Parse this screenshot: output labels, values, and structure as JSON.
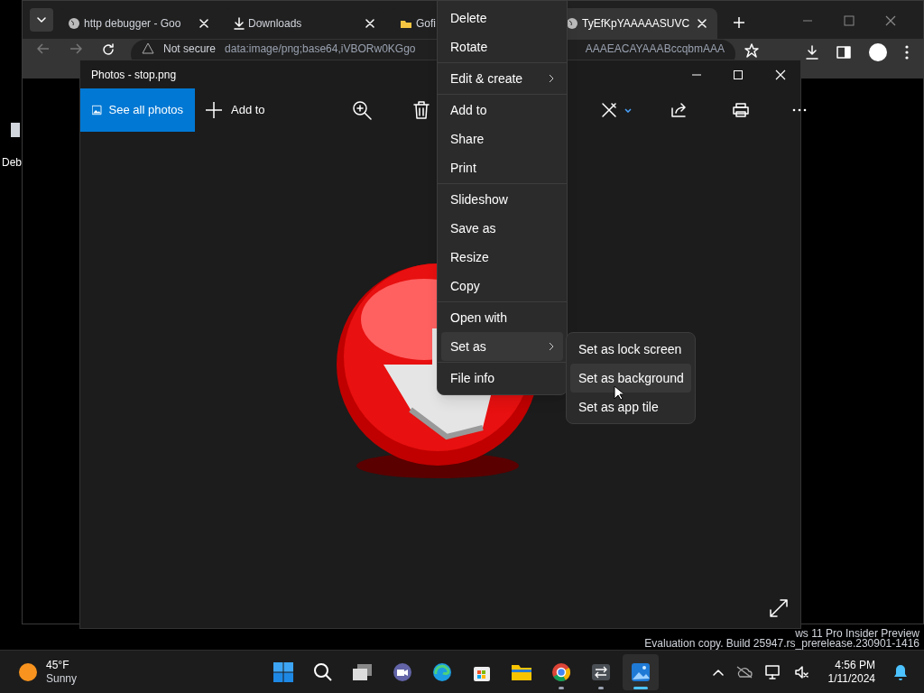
{
  "desktop": {
    "icon_label": "Deb"
  },
  "browser": {
    "tabs": [
      {
        "kind": "globe",
        "title": "http debugger - Goo",
        "selected": false
      },
      {
        "kind": "download",
        "title": "Downloads",
        "selected": false
      },
      {
        "kind": "folder",
        "title": "Gofi",
        "selected": false
      },
      {
        "kind": "globe",
        "title": "TyEfKpYAAAAASUVC",
        "selected": true
      }
    ],
    "address": {
      "security": "Not secure",
      "url_start": "data:image/png;base64,iVBORw0KGgo",
      "url_end": "AAAEACAYAAABccqbmAAA"
    }
  },
  "photos": {
    "title": "Photos - stop.png",
    "see_all": "See all photos",
    "add_to": "Add to"
  },
  "context_menu": {
    "groups": [
      [
        {
          "label": "Delete",
          "kind": "command",
          "selected": false
        },
        {
          "label": "Rotate",
          "kind": "command",
          "selected": false
        }
      ],
      [
        {
          "label": "Edit & create",
          "kind": "submenu",
          "selected": false
        }
      ],
      [
        {
          "label": "Add to",
          "kind": "command",
          "selected": false
        },
        {
          "label": "Share",
          "kind": "command",
          "selected": false
        },
        {
          "label": "Print",
          "kind": "command",
          "selected": false
        }
      ],
      [
        {
          "label": "Slideshow",
          "kind": "command",
          "selected": false
        },
        {
          "label": "Save as",
          "kind": "command",
          "selected": false
        },
        {
          "label": "Resize",
          "kind": "command",
          "selected": false
        },
        {
          "label": "Copy",
          "kind": "command",
          "selected": false
        }
      ],
      [
        {
          "label": "Open with",
          "kind": "command",
          "selected": false
        },
        {
          "label": "Set as",
          "kind": "submenu",
          "selected": true
        }
      ],
      [
        {
          "label": "File info",
          "kind": "command",
          "selected": false
        }
      ]
    ]
  },
  "submenu": [
    {
      "label": "Set as lock screen",
      "selected": false
    },
    {
      "label": "Set as background",
      "selected": true
    },
    {
      "label": "Set as app tile",
      "selected": false
    }
  ],
  "watermark": [
    "ws 11 Pro Insider Preview",
    "Evaluation copy. Build 25947.rs_prerelease.230901-1416"
  ],
  "taskbar": {
    "weather": {
      "temp": "45°F",
      "condition": "Sunny"
    },
    "apps": [
      {
        "kind": "start",
        "running": false,
        "selected": false
      },
      {
        "kind": "search",
        "running": false,
        "selected": false
      },
      {
        "kind": "taskview",
        "running": false,
        "selected": false
      },
      {
        "kind": "meet",
        "running": false,
        "selected": false
      },
      {
        "kind": "edge",
        "running": false,
        "selected": false
      },
      {
        "kind": "store",
        "running": false,
        "selected": false
      },
      {
        "kind": "files",
        "running": false,
        "selected": false
      },
      {
        "kind": "chrome",
        "running": true,
        "selected": false
      },
      {
        "kind": "transfer",
        "running": true,
        "selected": false
      },
      {
        "kind": "photos",
        "running": true,
        "selected": true
      }
    ],
    "clock": {
      "time": "4:56 PM",
      "date": "1/11/2024"
    }
  }
}
